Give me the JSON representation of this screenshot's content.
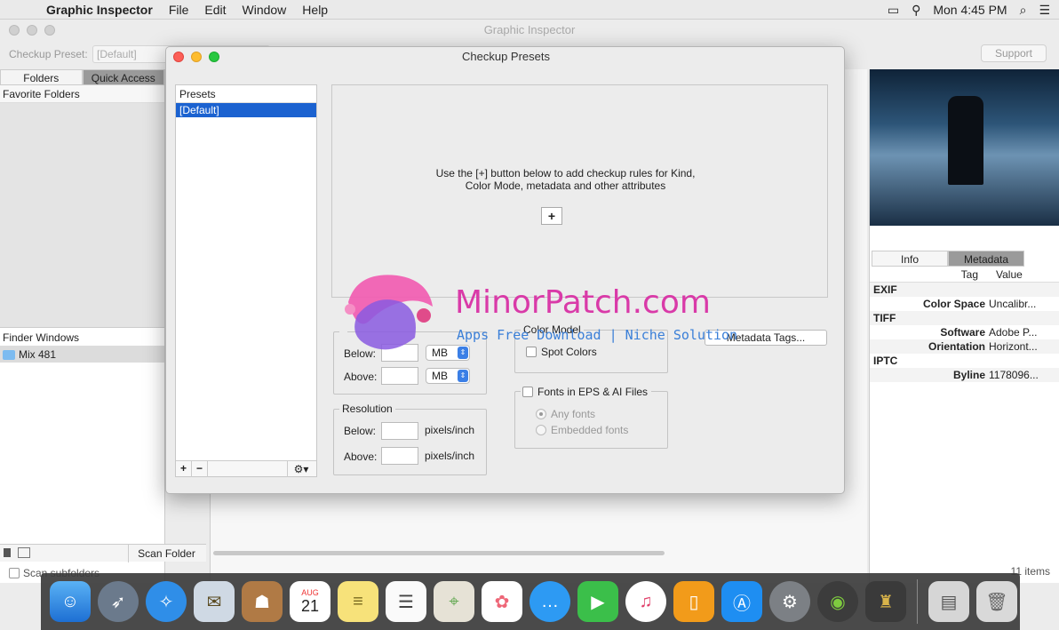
{
  "menubar": {
    "app_name": "Graphic Inspector",
    "menus": [
      "File",
      "Edit",
      "Window",
      "Help"
    ],
    "clock": "Mon 4:45 PM"
  },
  "main_window": {
    "title": "Graphic Inspector",
    "preset_label": "Checkup Preset:",
    "preset_value": "[Default]",
    "support_label": "Support",
    "tabs": [
      "Folders",
      "Quick Access"
    ],
    "favorite_folders_label": "Favorite Folders",
    "finder_windows_label": "Finder Windows",
    "finder_items": [
      "Mix 481"
    ],
    "scan_folder_label": "Scan Folder",
    "scan_subfolders_label": "Scan subfolders",
    "items_count": "11 items"
  },
  "inspector": {
    "tabs": [
      "Info",
      "Metadata"
    ],
    "col_tag": "Tag",
    "col_value": "Value",
    "rows": [
      {
        "group": "EXIF"
      },
      {
        "tag": "Color Space",
        "value": "Uncalibr..."
      },
      {
        "group": "TIFF"
      },
      {
        "tag": "Software",
        "value": "Adobe P..."
      },
      {
        "tag": "Orientation",
        "value": "Horizont..."
      },
      {
        "group": "IPTC"
      },
      {
        "tag": "Byline",
        "value": "1178096..."
      }
    ]
  },
  "dialog": {
    "title": "Checkup Presets",
    "presets_header": "Presets",
    "selected_preset": "[Default]",
    "rules_message_line1": "Use the [+] button below to add checkup rules for Kind,",
    "rules_message_line2": "Color Mode, metadata and other attributes",
    "add_rule": "+",
    "file_size": {
      "below_label": "Below:",
      "above_label": "Above:",
      "unit": "MB"
    },
    "resolution": {
      "legend": "Resolution",
      "below_label": "Below:",
      "above_label": "Above:",
      "unit": "pixels/inch"
    },
    "color_model": {
      "legend": "Color Model",
      "spot_colors": "Spot Colors"
    },
    "metadata_tags_button": "Metadata Tags...",
    "fonts": {
      "legend": "Fonts in EPS & AI Files",
      "any_fonts": "Any fonts",
      "embedded_fonts": "Embedded fonts"
    },
    "list_add": "+",
    "list_remove": "−"
  },
  "watermark": {
    "title": "MinorPatch.com",
    "subtitle": "Apps Free Download | Niche Solution"
  },
  "dock": {
    "date_month": "AUG",
    "date_day": "21"
  }
}
